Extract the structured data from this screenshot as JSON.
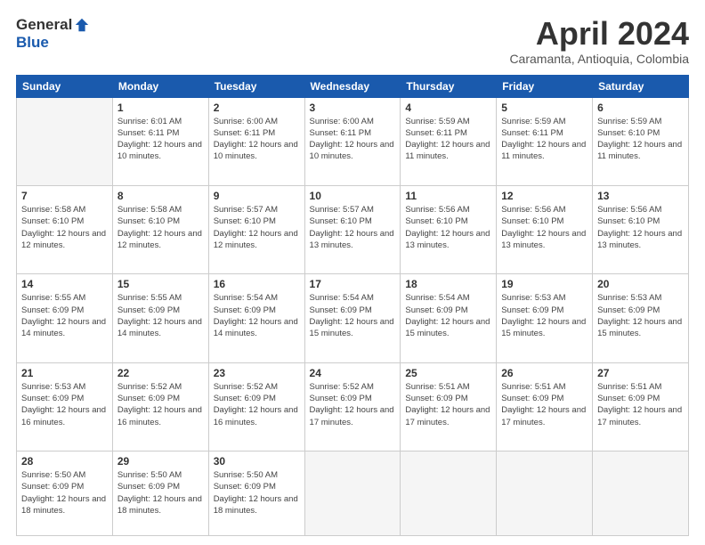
{
  "header": {
    "logo_general": "General",
    "logo_blue": "Blue",
    "month_title": "April 2024",
    "location": "Caramanta, Antioquia, Colombia"
  },
  "days_of_week": [
    "Sunday",
    "Monday",
    "Tuesday",
    "Wednesday",
    "Thursday",
    "Friday",
    "Saturday"
  ],
  "weeks": [
    [
      {
        "day": "",
        "sunrise": "",
        "sunset": "",
        "daylight": "",
        "empty": true
      },
      {
        "day": "1",
        "sunrise": "Sunrise: 6:01 AM",
        "sunset": "Sunset: 6:11 PM",
        "daylight": "Daylight: 12 hours and 10 minutes."
      },
      {
        "day": "2",
        "sunrise": "Sunrise: 6:00 AM",
        "sunset": "Sunset: 6:11 PM",
        "daylight": "Daylight: 12 hours and 10 minutes."
      },
      {
        "day": "3",
        "sunrise": "Sunrise: 6:00 AM",
        "sunset": "Sunset: 6:11 PM",
        "daylight": "Daylight: 12 hours and 10 minutes."
      },
      {
        "day": "4",
        "sunrise": "Sunrise: 5:59 AM",
        "sunset": "Sunset: 6:11 PM",
        "daylight": "Daylight: 12 hours and 11 minutes."
      },
      {
        "day": "5",
        "sunrise": "Sunrise: 5:59 AM",
        "sunset": "Sunset: 6:11 PM",
        "daylight": "Daylight: 12 hours and 11 minutes."
      },
      {
        "day": "6",
        "sunrise": "Sunrise: 5:59 AM",
        "sunset": "Sunset: 6:10 PM",
        "daylight": "Daylight: 12 hours and 11 minutes."
      }
    ],
    [
      {
        "day": "7",
        "sunrise": "Sunrise: 5:58 AM",
        "sunset": "Sunset: 6:10 PM",
        "daylight": "Daylight: 12 hours and 12 minutes."
      },
      {
        "day": "8",
        "sunrise": "Sunrise: 5:58 AM",
        "sunset": "Sunset: 6:10 PM",
        "daylight": "Daylight: 12 hours and 12 minutes."
      },
      {
        "day": "9",
        "sunrise": "Sunrise: 5:57 AM",
        "sunset": "Sunset: 6:10 PM",
        "daylight": "Daylight: 12 hours and 12 minutes."
      },
      {
        "day": "10",
        "sunrise": "Sunrise: 5:57 AM",
        "sunset": "Sunset: 6:10 PM",
        "daylight": "Daylight: 12 hours and 13 minutes."
      },
      {
        "day": "11",
        "sunrise": "Sunrise: 5:56 AM",
        "sunset": "Sunset: 6:10 PM",
        "daylight": "Daylight: 12 hours and 13 minutes."
      },
      {
        "day": "12",
        "sunrise": "Sunrise: 5:56 AM",
        "sunset": "Sunset: 6:10 PM",
        "daylight": "Daylight: 12 hours and 13 minutes."
      },
      {
        "day": "13",
        "sunrise": "Sunrise: 5:56 AM",
        "sunset": "Sunset: 6:10 PM",
        "daylight": "Daylight: 12 hours and 13 minutes."
      }
    ],
    [
      {
        "day": "14",
        "sunrise": "Sunrise: 5:55 AM",
        "sunset": "Sunset: 6:09 PM",
        "daylight": "Daylight: 12 hours and 14 minutes."
      },
      {
        "day": "15",
        "sunrise": "Sunrise: 5:55 AM",
        "sunset": "Sunset: 6:09 PM",
        "daylight": "Daylight: 12 hours and 14 minutes."
      },
      {
        "day": "16",
        "sunrise": "Sunrise: 5:54 AM",
        "sunset": "Sunset: 6:09 PM",
        "daylight": "Daylight: 12 hours and 14 minutes."
      },
      {
        "day": "17",
        "sunrise": "Sunrise: 5:54 AM",
        "sunset": "Sunset: 6:09 PM",
        "daylight": "Daylight: 12 hours and 15 minutes."
      },
      {
        "day": "18",
        "sunrise": "Sunrise: 5:54 AM",
        "sunset": "Sunset: 6:09 PM",
        "daylight": "Daylight: 12 hours and 15 minutes."
      },
      {
        "day": "19",
        "sunrise": "Sunrise: 5:53 AM",
        "sunset": "Sunset: 6:09 PM",
        "daylight": "Daylight: 12 hours and 15 minutes."
      },
      {
        "day": "20",
        "sunrise": "Sunrise: 5:53 AM",
        "sunset": "Sunset: 6:09 PM",
        "daylight": "Daylight: 12 hours and 15 minutes."
      }
    ],
    [
      {
        "day": "21",
        "sunrise": "Sunrise: 5:53 AM",
        "sunset": "Sunset: 6:09 PM",
        "daylight": "Daylight: 12 hours and 16 minutes."
      },
      {
        "day": "22",
        "sunrise": "Sunrise: 5:52 AM",
        "sunset": "Sunset: 6:09 PM",
        "daylight": "Daylight: 12 hours and 16 minutes."
      },
      {
        "day": "23",
        "sunrise": "Sunrise: 5:52 AM",
        "sunset": "Sunset: 6:09 PM",
        "daylight": "Daylight: 12 hours and 16 minutes."
      },
      {
        "day": "24",
        "sunrise": "Sunrise: 5:52 AM",
        "sunset": "Sunset: 6:09 PM",
        "daylight": "Daylight: 12 hours and 17 minutes."
      },
      {
        "day": "25",
        "sunrise": "Sunrise: 5:51 AM",
        "sunset": "Sunset: 6:09 PM",
        "daylight": "Daylight: 12 hours and 17 minutes."
      },
      {
        "day": "26",
        "sunrise": "Sunrise: 5:51 AM",
        "sunset": "Sunset: 6:09 PM",
        "daylight": "Daylight: 12 hours and 17 minutes."
      },
      {
        "day": "27",
        "sunrise": "Sunrise: 5:51 AM",
        "sunset": "Sunset: 6:09 PM",
        "daylight": "Daylight: 12 hours and 17 minutes."
      }
    ],
    [
      {
        "day": "28",
        "sunrise": "Sunrise: 5:50 AM",
        "sunset": "Sunset: 6:09 PM",
        "daylight": "Daylight: 12 hours and 18 minutes."
      },
      {
        "day": "29",
        "sunrise": "Sunrise: 5:50 AM",
        "sunset": "Sunset: 6:09 PM",
        "daylight": "Daylight: 12 hours and 18 minutes."
      },
      {
        "day": "30",
        "sunrise": "Sunrise: 5:50 AM",
        "sunset": "Sunset: 6:09 PM",
        "daylight": "Daylight: 12 hours and 18 minutes."
      },
      {
        "day": "",
        "sunrise": "",
        "sunset": "",
        "daylight": "",
        "empty": true
      },
      {
        "day": "",
        "sunrise": "",
        "sunset": "",
        "daylight": "",
        "empty": true
      },
      {
        "day": "",
        "sunrise": "",
        "sunset": "",
        "daylight": "",
        "empty": true
      },
      {
        "day": "",
        "sunrise": "",
        "sunset": "",
        "daylight": "",
        "empty": true
      }
    ]
  ]
}
